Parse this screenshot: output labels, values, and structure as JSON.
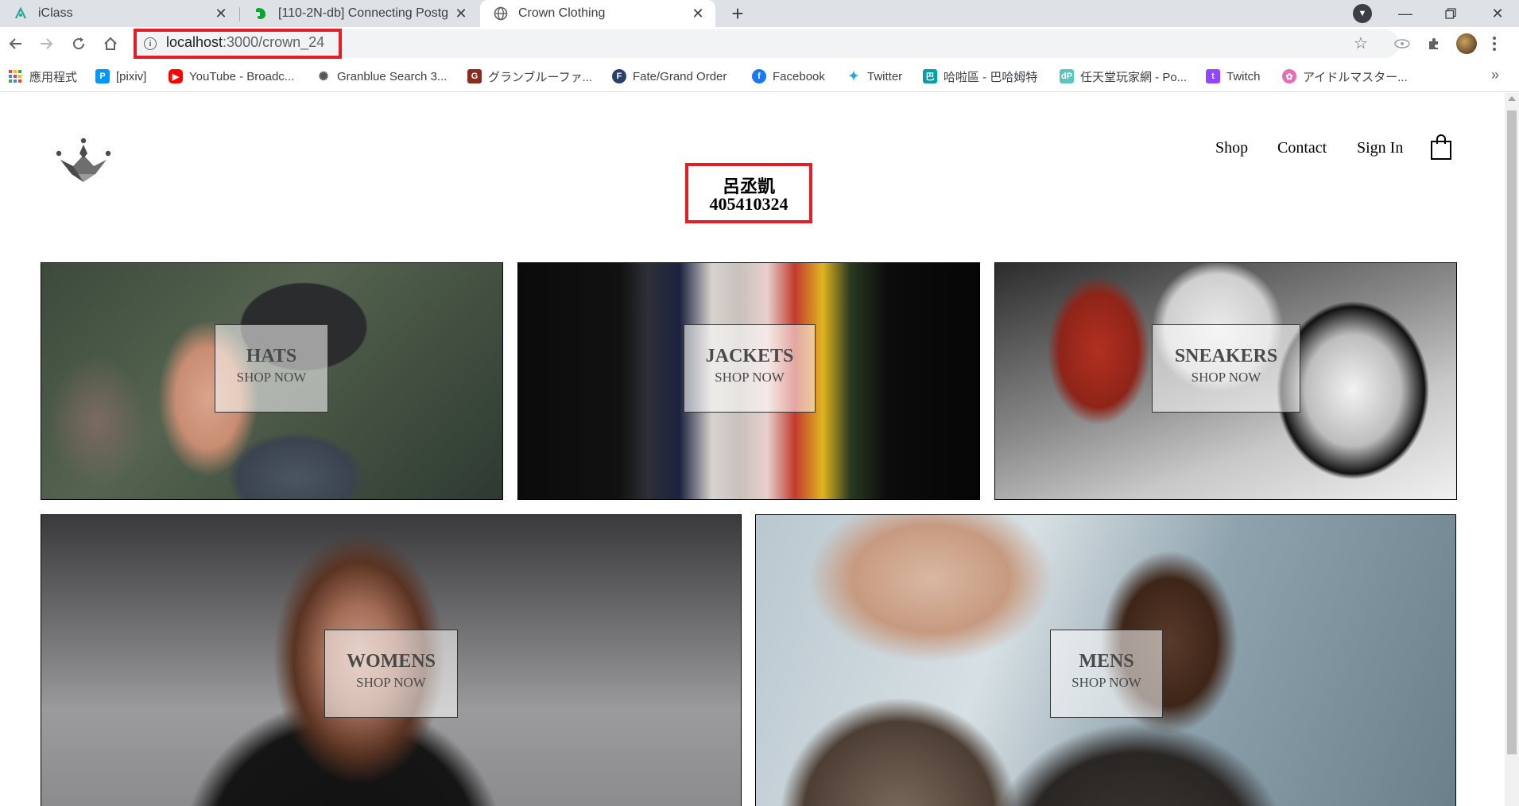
{
  "browser": {
    "tabs": [
      {
        "title": "iClass",
        "icon": "iclass-icon",
        "active": false
      },
      {
        "title": "[110-2N-db] Connecting Postg",
        "icon": "evernote-icon",
        "active": false
      },
      {
        "title": "Crown Clothing",
        "icon": "globe-icon",
        "active": true
      }
    ],
    "url_host": "localhost",
    "url_path": ":3000/crown_24",
    "bookmarks": [
      {
        "label": "應用程式",
        "icon": "apps-icon",
        "color": "#ea4335"
      },
      {
        "label": "[pixiv]",
        "icon": "pixiv-icon",
        "color": "#0096fa"
      },
      {
        "label": "YouTube - Broadc...",
        "icon": "youtube-icon",
        "color": "#ff0000"
      },
      {
        "label": "Granblue Search 3...",
        "icon": "granblue-icon",
        "color": "#555555"
      },
      {
        "label": "グランブルーファ...",
        "icon": "gbf-icon",
        "color": "#8a2b1d"
      },
      {
        "label": "Fate/Grand Order",
        "icon": "fgo-icon",
        "color": "#2b3f6b"
      },
      {
        "label": "Facebook",
        "icon": "facebook-icon",
        "color": "#1877f2"
      },
      {
        "label": "Twitter",
        "icon": "twitter-icon",
        "color": "#1da1f2"
      },
      {
        "label": "哈啦區 - 巴哈姆特",
        "icon": "bahamut-icon",
        "color": "#00a0a8"
      },
      {
        "label": "任天堂玩家網 - Po...",
        "icon": "nintendo-icon",
        "color": "#5bc6c1"
      },
      {
        "label": "Twitch",
        "icon": "twitch-icon",
        "color": "#9146ff"
      },
      {
        "label": "アイドルマスター...",
        "icon": "idolmaster-icon",
        "color": "#e86cb5"
      }
    ]
  },
  "header": {
    "nav": {
      "shop": "Shop",
      "contact": "Contact",
      "sign_in": "Sign In"
    }
  },
  "student": {
    "name": "呂丞凱",
    "id": "405410324"
  },
  "categories": [
    {
      "title": "HATS",
      "subtitle": "SHOP NOW"
    },
    {
      "title": "JACKETS",
      "subtitle": "SHOP NOW"
    },
    {
      "title": "SNEAKERS",
      "subtitle": "SHOP NOW"
    },
    {
      "title": "WOMENS",
      "subtitle": "SHOP NOW"
    },
    {
      "title": "MENS",
      "subtitle": "SHOP NOW"
    }
  ],
  "colors": {
    "highlight": "#e21f26",
    "chrome_bg": "#dee1e6"
  }
}
